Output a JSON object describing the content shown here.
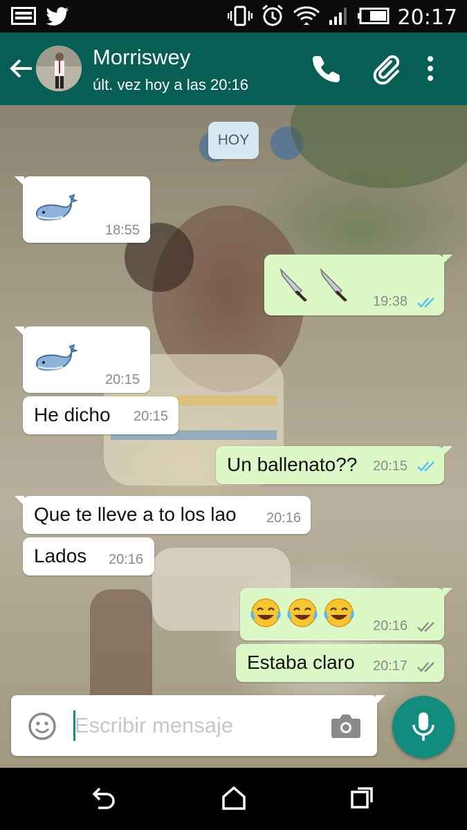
{
  "status_bar": {
    "time": "20:17",
    "icons": [
      "image-icon",
      "twitter-icon",
      "vibrate-icon",
      "alarm-icon",
      "wifi-icon",
      "signal-icon",
      "battery-icon"
    ]
  },
  "header": {
    "contact_name": "Morriswey",
    "last_seen": "últ. vez hoy a las 20:16",
    "icons": [
      "back-arrow-icon",
      "phone-icon",
      "paperclip-icon",
      "overflow-menu-icon"
    ],
    "bg_color": "#075e54"
  },
  "chat": {
    "date_chip": "HOY",
    "messages": [
      {
        "direction": "in",
        "content": "whale-emoji",
        "text": "",
        "time": "18:55"
      },
      {
        "direction": "out",
        "content": "knife-emoji knife-emoji",
        "text": "",
        "time": "19:38",
        "read": true
      },
      {
        "direction": "in",
        "content": "whale-emoji",
        "text": "",
        "time": "20:15"
      },
      {
        "direction": "in",
        "text": "He dicho",
        "time": "20:15"
      },
      {
        "direction": "out",
        "text": "Un ballenato??",
        "time": "20:15",
        "read": true
      },
      {
        "direction": "in",
        "text": "Que te lleve a to los lao",
        "time": "20:16"
      },
      {
        "direction": "in",
        "text": "Lados",
        "time": "20:16"
      },
      {
        "direction": "out",
        "content": "joy-emoji joy-emoji joy-emoji",
        "text": "",
        "time": "20:16",
        "read": false
      },
      {
        "direction": "out",
        "text": "Estaba claro",
        "time": "20:17",
        "read": false
      }
    ],
    "colors": {
      "incoming": "#ffffff",
      "outgoing": "#dcf8c6",
      "read_ticks": "#4fc3f7",
      "unread_ticks": "#8a8a8a"
    }
  },
  "composer": {
    "placeholder": "Escribir mensaje",
    "value": "",
    "icons": [
      "smiley-icon",
      "camera-icon",
      "mic-icon"
    ],
    "accent": "#128c7e"
  },
  "nav_bar": {
    "icons": [
      "back-icon",
      "home-icon",
      "recents-icon"
    ]
  }
}
